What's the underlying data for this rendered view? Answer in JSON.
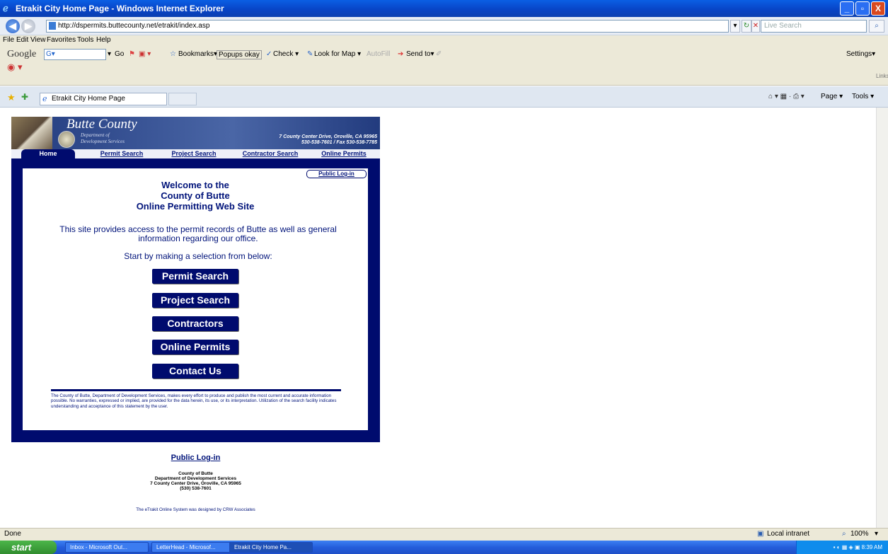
{
  "window": {
    "title": "Etrakit City Home Page - Windows Internet Explorer",
    "minimize": "_",
    "maximize": "▫",
    "close": "X"
  },
  "address_bar": {
    "url": "http://dspermits.buttecounty.net/etrakit/index.asp",
    "search_placeholder": "Live Search"
  },
  "menu": [
    "File",
    "Edit",
    "View",
    "Favorites",
    "Tools",
    "Help"
  ],
  "google_toolbar": {
    "logo": "Google",
    "search_value": "G▾",
    "go": "Go",
    "bookmarks": "Bookmarks▾",
    "popups": "Popups okay",
    "check": "Check ▾",
    "look_for_map": "Look for Map ▾",
    "autofill": "AutoFill",
    "send_to": "Send to▾",
    "settings": "Settings▾",
    "links": "Links"
  },
  "tab": {
    "label": "Etrakit City Home Page"
  },
  "command_bar": {
    "page": "Page ▾",
    "tools": "Tools ▾"
  },
  "banner": {
    "county": "Butte County",
    "dept_line1": "Department of",
    "dept_line2": "Development Services",
    "address_line1": "7 County Center Drive, Oroville, CA 95965",
    "address_line2": "530-538-7601 / Fax 530-538-7785"
  },
  "nav": [
    "Home",
    "Permit Search",
    "Project Search",
    "Contractor Search",
    "Online Permits"
  ],
  "public_login_small": "Public Log-in",
  "welcome": {
    "line1": "Welcome to the",
    "line2": "County of Butte",
    "line3": "Online Permitting Web Site"
  },
  "intro": "This site provides access to the permit records of Butte as well as general information regarding our office.",
  "start_by": "Start by making a selection from below:",
  "buttons": [
    "Permit Search",
    "Project Search",
    "Contractors",
    "Online Permits",
    "Contact Us"
  ],
  "disclaimer": "The County of Butte, Department of Development Services, makes every effort to produce and publish the most current and accurate information possible. No warranties, expressed or implied, are provided for the data herein, its use, or its interpretation. Utilization of the search facility indicates understanding and acceptance of this statement by the user.",
  "footer": {
    "login_link": "Public Log-in",
    "line1": "County of Butte",
    "line2": "Department of Development Services",
    "line3": "7 County Center Drive, Oroville, CA 95965",
    "line4": "(530) 538-7601",
    "credit": "The eTrakit Online System was designed by CRW Associates"
  },
  "status_bar": {
    "text": "Done",
    "zone": "Local intranet",
    "zoom": "100%"
  },
  "taskbar": {
    "start": "start",
    "items": [
      "Inbox - Microsoft Out...",
      "LetterHead - Microsof...",
      "Etrakit City Home Pa..."
    ],
    "clock": "8:39 AM"
  }
}
